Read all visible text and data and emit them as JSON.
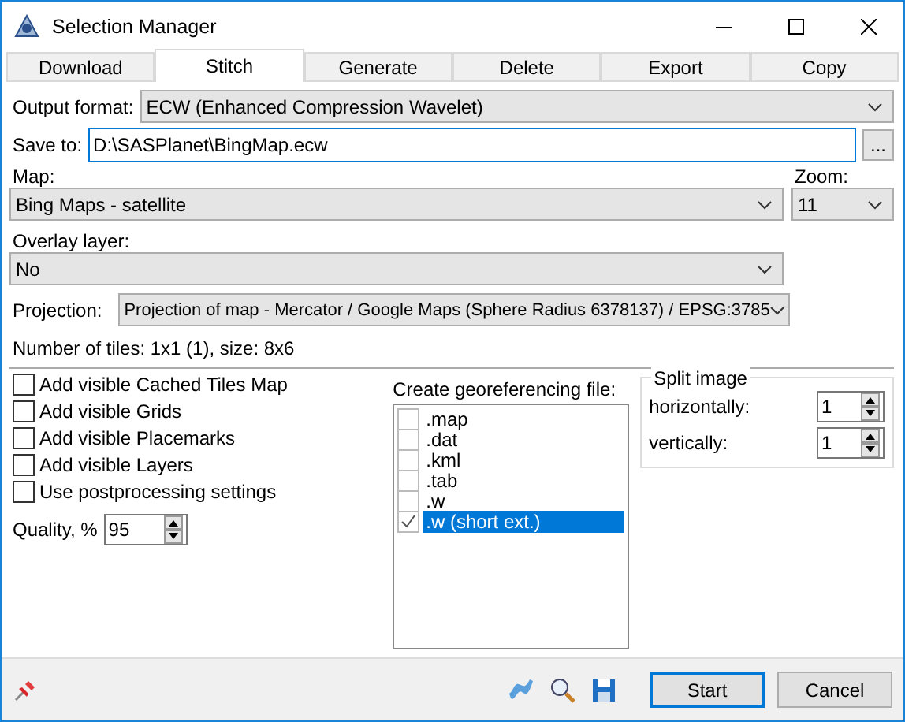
{
  "window": {
    "title": "Selection Manager"
  },
  "tabs": [
    {
      "label": "Download",
      "selected": false
    },
    {
      "label": "Stitch",
      "selected": true
    },
    {
      "label": "Generate",
      "selected": false
    },
    {
      "label": "Delete",
      "selected": false
    },
    {
      "label": "Export",
      "selected": false
    },
    {
      "label": "Copy",
      "selected": false
    }
  ],
  "output_format": {
    "label": "Output format:",
    "value": "ECW (Enhanced Compression Wavelet)"
  },
  "save_to": {
    "label": "Save to:",
    "value": "D:\\SASPlanet\\BingMap.ecw",
    "browse": "..."
  },
  "map": {
    "label": "Map:",
    "value": "Bing Maps - satellite"
  },
  "zoom": {
    "label": "Zoom:",
    "value": "11"
  },
  "overlay": {
    "label": "Overlay layer:",
    "value": "No"
  },
  "projection": {
    "label": "Projection:",
    "value": "Projection of map - Mercator / Google Maps (Sphere Radius 6378137) / EPSG:3785"
  },
  "tiles_info": "Number of tiles: 1x1 (1), size: 8x6",
  "options": [
    {
      "label": "Add visible Cached Tiles Map",
      "checked": false
    },
    {
      "label": "Add visible Grids",
      "checked": false
    },
    {
      "label": "Add visible Placemarks",
      "checked": false
    },
    {
      "label": "Add visible Layers",
      "checked": false
    },
    {
      "label": "Use postprocessing settings",
      "checked": false
    }
  ],
  "quality": {
    "label": "Quality, %",
    "value": "95"
  },
  "georef": {
    "label": "Create georeferencing file:",
    "items": [
      {
        "label": ".map",
        "checked": false,
        "selected": false
      },
      {
        "label": ".dat",
        "checked": false,
        "selected": false
      },
      {
        "label": ".kml",
        "checked": false,
        "selected": false
      },
      {
        "label": ".tab",
        "checked": false,
        "selected": false
      },
      {
        "label": ".w",
        "checked": false,
        "selected": false
      },
      {
        "label": ".w (short ext.)",
        "checked": true,
        "selected": true
      }
    ]
  },
  "split": {
    "title": "Split image",
    "fields": [
      {
        "label": "horizontally:",
        "value": "1"
      },
      {
        "label": "vertically:",
        "value": "1"
      }
    ]
  },
  "buttons": [
    {
      "label": "Start",
      "default": true
    },
    {
      "label": "Cancel",
      "default": false
    }
  ]
}
